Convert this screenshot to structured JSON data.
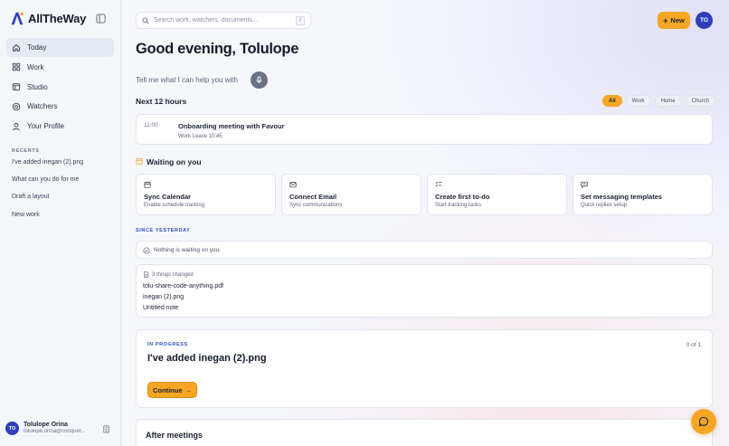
{
  "brand": {
    "name": "AllTheWay"
  },
  "sidebar": {
    "nav": [
      {
        "label": "Today",
        "icon": "home-icon",
        "active": true
      },
      {
        "label": "Work",
        "icon": "grid-icon"
      },
      {
        "label": "Studio",
        "icon": "studio-icon"
      },
      {
        "label": "Watchers",
        "icon": "watchers-icon"
      },
      {
        "label": "Your Profile",
        "icon": "user-icon"
      }
    ],
    "recents_title": "RECENTS",
    "recents": [
      "I've added inegan (2).png",
      "What can you do for me",
      "Draft a layout",
      "New work"
    ],
    "user": {
      "initials": "TO",
      "name": "Tolulope Orina",
      "email": "tolulope.orina@conquer..."
    }
  },
  "header": {
    "search_placeholder": "Search work, watchers, documents...",
    "search_shortcut": "/",
    "new_label": "New",
    "avatar_initials": "TO"
  },
  "greeting": "Good evening, Tolulope",
  "prompt": "Tell me what I can help you with",
  "next_hours": {
    "title": "Next 12 hours",
    "filters": [
      "All",
      "Work",
      "Home",
      "Church"
    ],
    "active_filter": "All",
    "event": {
      "time": "11:00",
      "title": "Onboarding meeting with Favour",
      "meta": "Work  Leave 10:45"
    }
  },
  "waiting": {
    "title": "Waiting on you",
    "cards": [
      {
        "title": "Sync Calendar",
        "subtitle": "Enable schedule tracking",
        "icon": "calendar-icon"
      },
      {
        "title": "Connect Email",
        "subtitle": "Sync communications",
        "icon": "mail-icon"
      },
      {
        "title": "Create first to-do",
        "subtitle": "Start tracking tasks",
        "icon": "checklist-icon"
      },
      {
        "title": "Set messaging templates",
        "subtitle": "Quick replies setup",
        "icon": "message-icon"
      }
    ]
  },
  "since": {
    "title": "SINCE YESTERDAY",
    "nothing": "Nothing is waiting on you.",
    "changes_count": "3 things changed",
    "changes": [
      "tolu-share-code-anything.pdf",
      "inegan (2).png",
      "Untitled note"
    ]
  },
  "in_progress": {
    "label": "IN PROGRESS",
    "count": "0 of 1",
    "title": "I've added inegan (2).png",
    "button": "Continue"
  },
  "after_meetings": {
    "title": "After meetings"
  },
  "colors": {
    "accent": "#f6a623",
    "primary": "#2f3fb8",
    "link": "#2b4ec2"
  }
}
